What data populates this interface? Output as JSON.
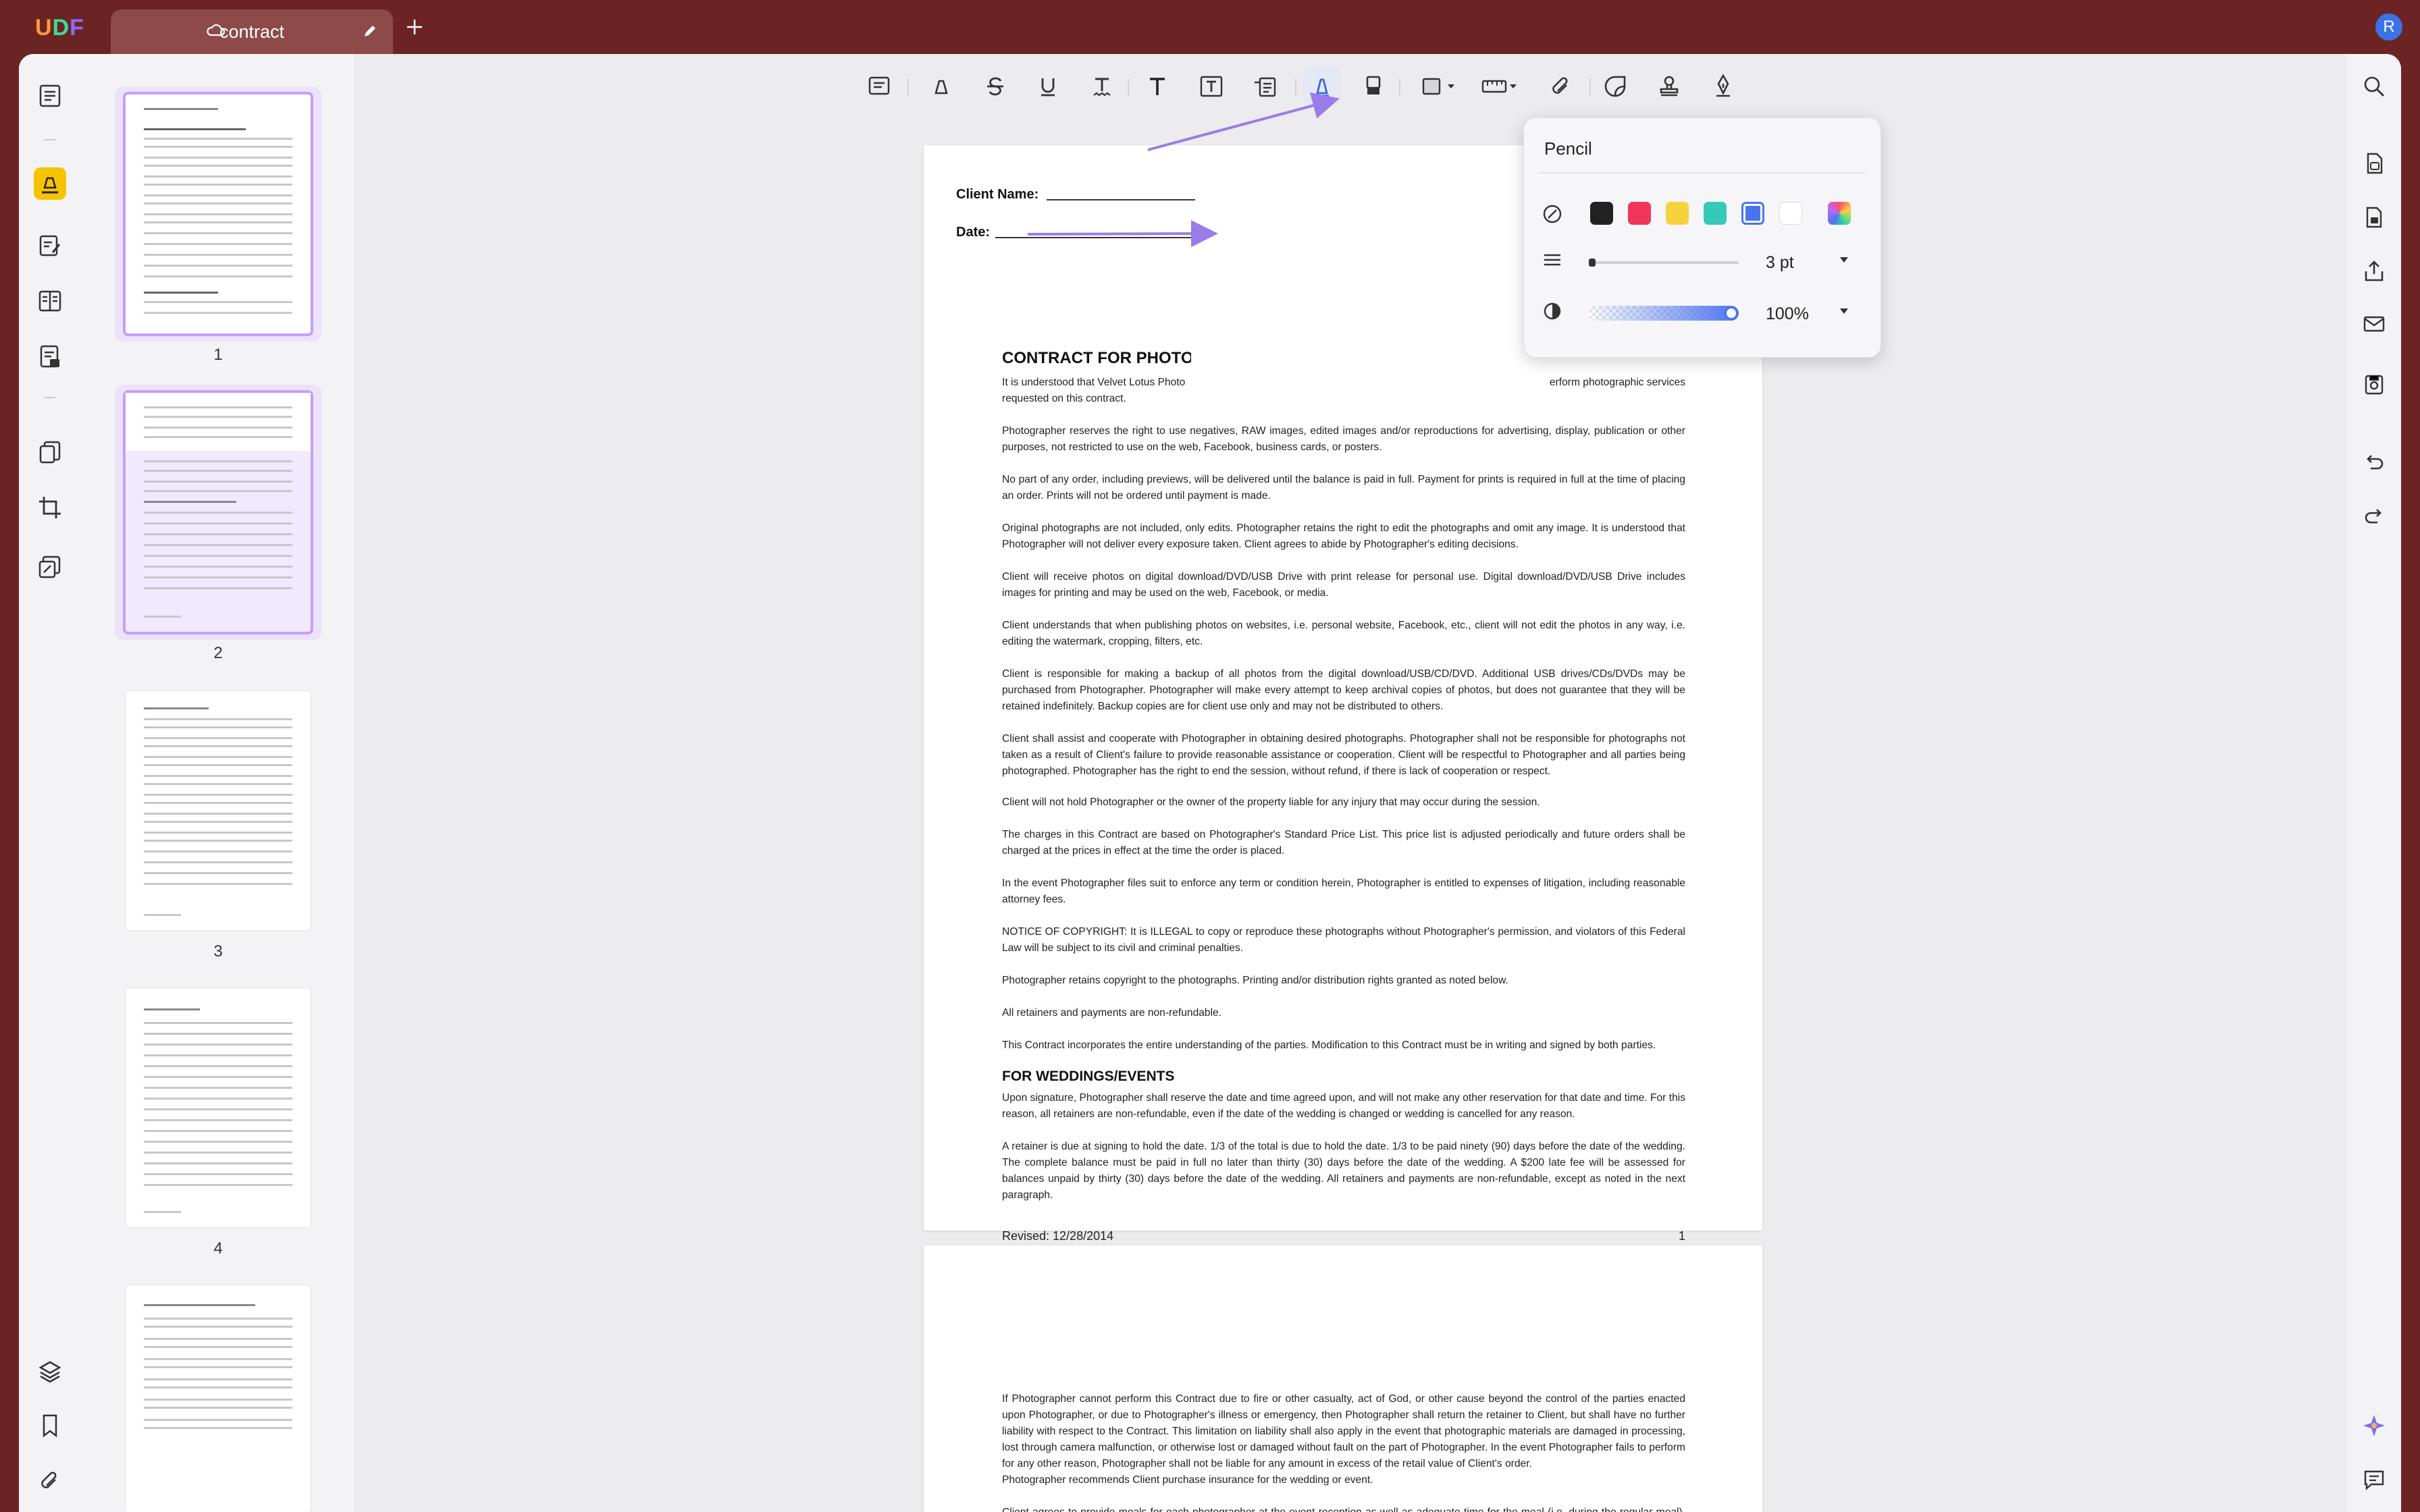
{
  "app": {
    "logo": "UPDF",
    "user_initial": "R"
  },
  "tab": {
    "title": "contract"
  },
  "thumbnails": [
    {
      "num": "1"
    },
    {
      "num": "2"
    },
    {
      "num": "3"
    },
    {
      "num": "4"
    }
  ],
  "pencil_popup": {
    "title": "Pencil",
    "colors": [
      "#222222",
      "#f0365a",
      "#f7d23e",
      "#35c9b8",
      "#4c74ee",
      "#ffffff"
    ],
    "selected_color": "#4c74ee",
    "thickness": "3 pt",
    "opacity": "100%"
  },
  "page1": {
    "client_name_label": "Client Name:",
    "date_label": "Date:",
    "heading": "CONTRACT FOR PHOTOGRAPHIC SERVICES",
    "intro_start": "It is understood that Velvet Lotus Photo",
    "intro_end": "erform photographic services",
    "intro_line2": "requested on this contract.",
    "paragraphs": [
      "Photographer reserves the right to use negatives, RAW images, edited images and/or reproductions for advertising, display, publication or other purposes, not restricted to use on the web, Facebook, business cards, or posters.",
      "No part of any order, including previews, will be delivered until the balance is paid in full. Payment for prints is required in full at the time of placing an order. Prints will not be ordered until payment is made.",
      "Original photographs are not included, only edits. Photographer retains the right to edit the photographs and omit any image. It is understood that Photographer will not deliver every exposure taken. Client agrees to abide by Photographer's editing decisions.",
      "Client will receive photos on digital download/DVD/USB Drive with print release for personal use. Digital download/DVD/USB Drive includes images for printing and may be used on the web, Facebook, or media.",
      "Client understands that when publishing photos on websites, i.e. personal website, Facebook, etc., client will not edit the photos in any way, i.e. editing the watermark, cropping, filters, etc.",
      "Client is responsible for making a backup of all photos from the digital download/USB/CD/DVD. Additional USB drives/CDs/DVDs may be purchased from Photographer. Photographer will make every attempt to keep archival copies of photos, but does not guarantee that they will be retained indefinitely. Backup copies are for client use only and may not be distributed to others.",
      "Client shall assist and cooperate with Photographer in obtaining desired photographs. Photographer shall not be responsible for photographs not taken as a result of Client's failure to provide reasonable assistance or cooperation. Client will be respectful to Photographer and all parties being photographed. Photographer has the right to end the session, without refund, if there is lack of cooperation or respect.",
      "Client will not hold Photographer or the owner of the property liable for any injury that may occur during the session.",
      "The charges in this Contract are based on Photographer's Standard Price List. This price list is adjusted periodically and future orders shall be charged at the prices in effect at the time the order is placed.",
      "In the event Photographer files suit to enforce any term or condition herein, Photographer is entitled to expenses of litigation, including reasonable attorney fees.",
      "NOTICE OF COPYRIGHT: It is ILLEGAL to copy or reproduce these photographs without Photographer's permission, and violators of this Federal Law will be subject to its civil and criminal penalties.",
      "Photographer retains copyright to the photographs. Printing and/or distribution rights granted as noted below.",
      "All retainers and payments are non-refundable.",
      "This Contract incorporates the entire understanding of the parties. Modification to this Contract must be in writing and signed by both parties."
    ],
    "heading2": "FOR WEDDINGS/EVENTS",
    "paragraphs2": [
      "Upon signature, Photographer shall reserve the date and time agreed upon, and will not make any other reservation for that date and time. For this reason, all retainers are non-refundable, even if the date of the wedding is changed or wedding is cancelled for any reason.",
      "A retainer is due at signing to hold the date. 1/3 of the total is due to hold the date. 1/3 to be paid ninety (90) days before the date of the wedding. The complete balance must be paid in full no later than thirty (30) days before the date of the wedding. A $200 late fee will be assessed for balances unpaid by thirty (30) days before the date of the wedding. All retainers and payments are non-refundable, except as noted in the next paragraph."
    ],
    "footer_revised": "Revised: 12/28/2014",
    "footer_page": "1"
  },
  "page2": {
    "paragraphs": [
      "If Photographer cannot perform this Contract due to fire or other casualty, act of God, or other cause beyond the control of the parties enacted upon Photographer, or due to Photographer's illness or emergency, then Photographer shall return the retainer to Client, but shall have no further liability with respect to the Contract. This limitation on liability shall also apply in the event that photographic materials are damaged in processing, lost through camera malfunction, or otherwise lost or damaged without fault on the part of Photographer. In the event Photographer fails to perform for any other reason, Photographer shall not be liable for any amount in excess of the retail value of Client's order.",
      "Photographer recommends Client purchase insurance for the wedding or event.",
      "Client agrees to provide meals for each photographer at the event reception as well as adequate time for the meal (i.e. during the regular meal). For events longer than eight (8) hours, two (2) meals for each photographer will be provided."
    ]
  }
}
